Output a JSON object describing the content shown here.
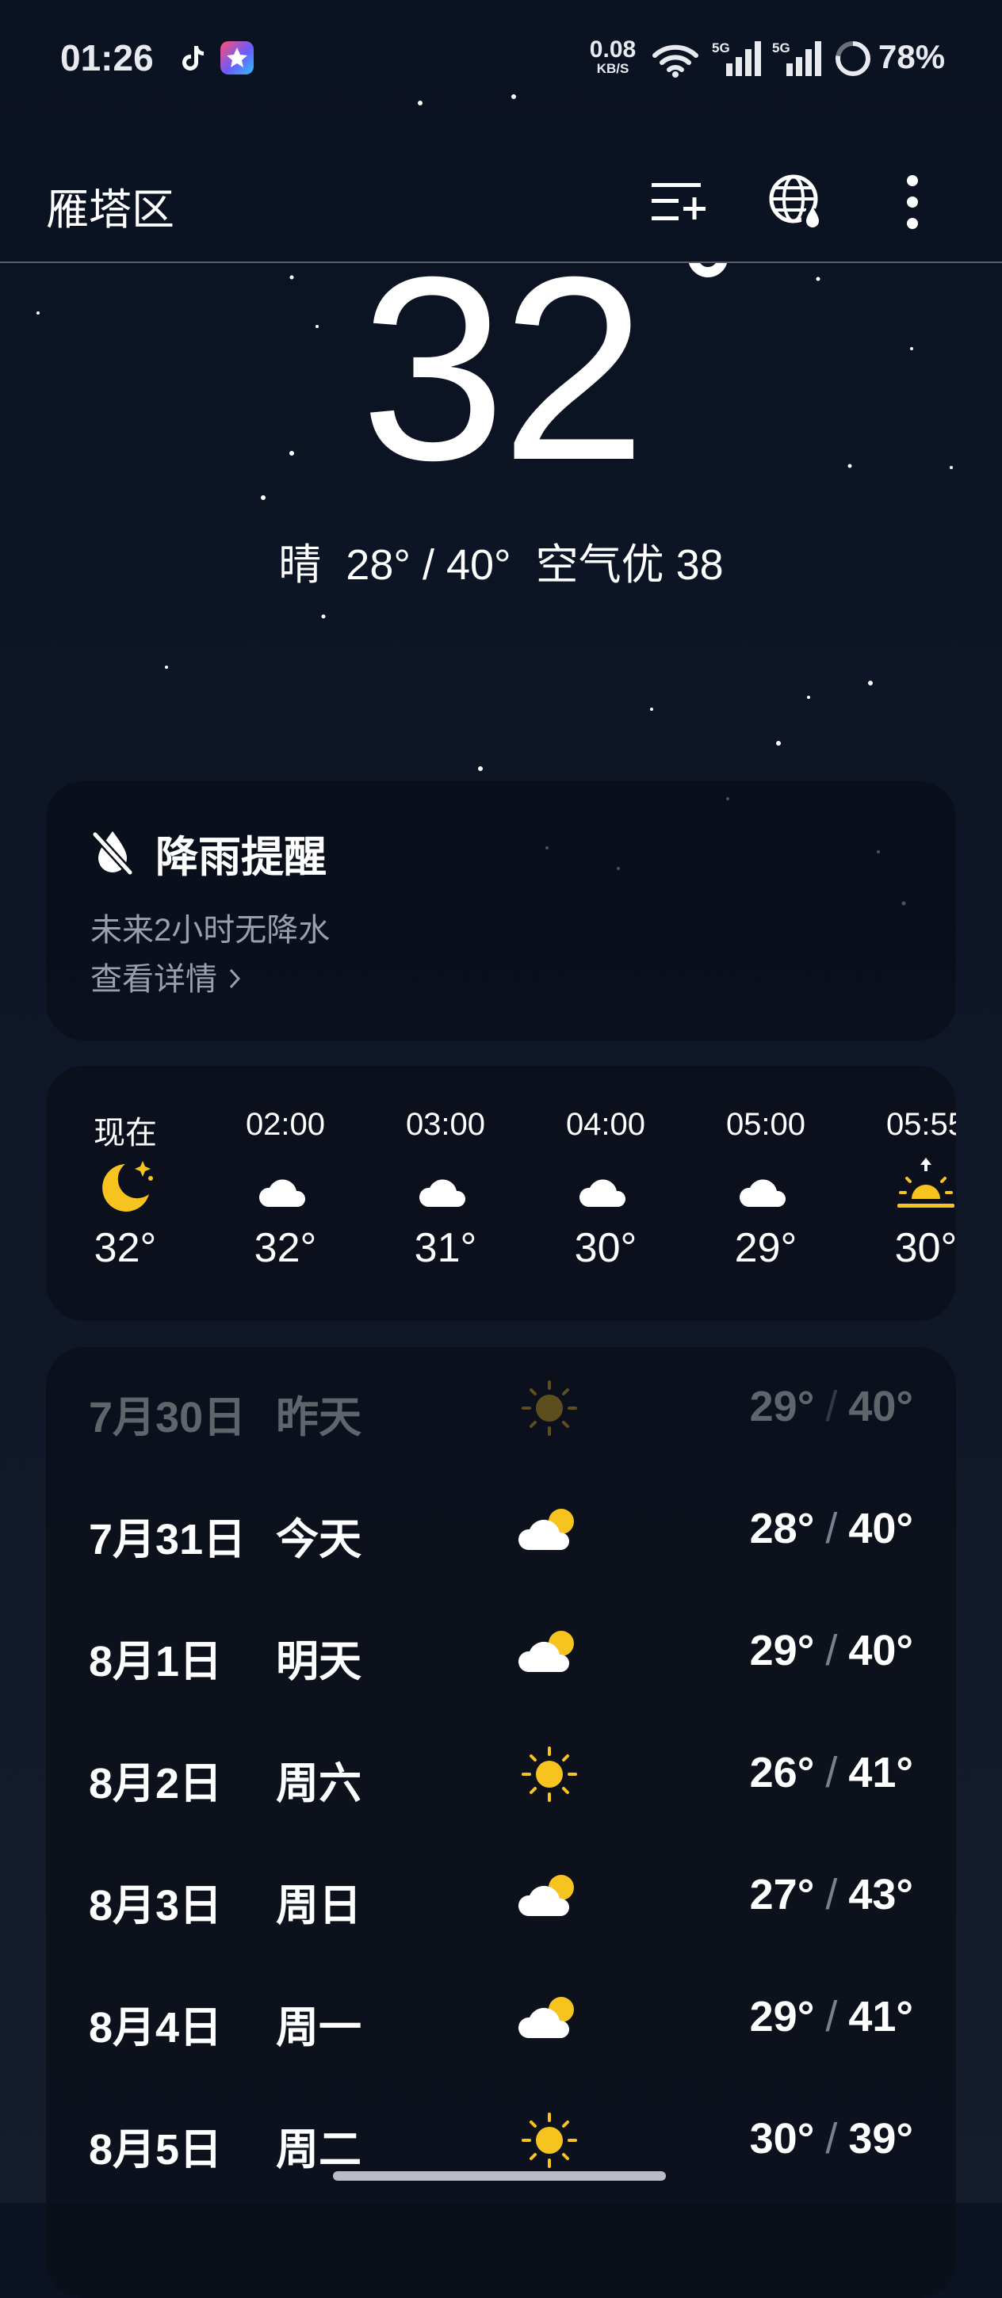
{
  "status_bar": {
    "time": "01:26",
    "net_speed_value": "0.08",
    "net_speed_unit": "KB/S",
    "signal1_label": "5G",
    "signal2_label": "5G",
    "battery": "78%"
  },
  "header": {
    "city": "雁塔区",
    "icons": [
      "manage-cities-icon",
      "globe-raindrop-icon",
      "more-vertical-icon"
    ]
  },
  "current": {
    "temperature": "32",
    "condition": "晴",
    "range": "28° / 40°",
    "aqi": "空气优 38"
  },
  "rain_alert": {
    "title": "降雨提醒",
    "description": "未来2小时无降水",
    "link": "查看详情"
  },
  "hourly": [
    {
      "time": "现在",
      "icon": "moon-stars-icon",
      "temp": "32°"
    },
    {
      "time": "02:00",
      "icon": "cloudy-night-icon",
      "temp": "32°"
    },
    {
      "time": "03:00",
      "icon": "cloudy-night-icon",
      "temp": "31°"
    },
    {
      "time": "04:00",
      "icon": "cloudy-night-icon",
      "temp": "30°"
    },
    {
      "time": "05:00",
      "icon": "cloudy-night-icon",
      "temp": "29°"
    },
    {
      "time": "05:55",
      "icon": "sunrise-icon",
      "temp": "30°"
    }
  ],
  "daily": [
    {
      "date": "7月30日",
      "weekday": "昨天",
      "icon": "sun-icon",
      "low": "29°",
      "high": "40°",
      "past": true
    },
    {
      "date": "7月31日",
      "weekday": "今天",
      "icon": "partly-cloudy-icon",
      "low": "28°",
      "high": "40°"
    },
    {
      "date": "8月1日",
      "weekday": "明天",
      "icon": "partly-cloudy-icon",
      "low": "29°",
      "high": "40°"
    },
    {
      "date": "8月2日",
      "weekday": "周六",
      "icon": "sun-icon",
      "low": "26°",
      "high": "41°"
    },
    {
      "date": "8月3日",
      "weekday": "周日",
      "icon": "partly-cloudy-icon",
      "low": "27°",
      "high": "43°"
    },
    {
      "date": "8月4日",
      "weekday": "周一",
      "icon": "partly-cloudy-icon",
      "low": "29°",
      "high": "41°"
    },
    {
      "date": "8月5日",
      "weekday": "周二",
      "icon": "sun-icon",
      "low": "30°",
      "high": "39°"
    }
  ],
  "colors": {
    "sun": "#f7c31f",
    "cloud": "#ffffff",
    "background_top": "#0b1221",
    "card": "#0a0e18"
  }
}
